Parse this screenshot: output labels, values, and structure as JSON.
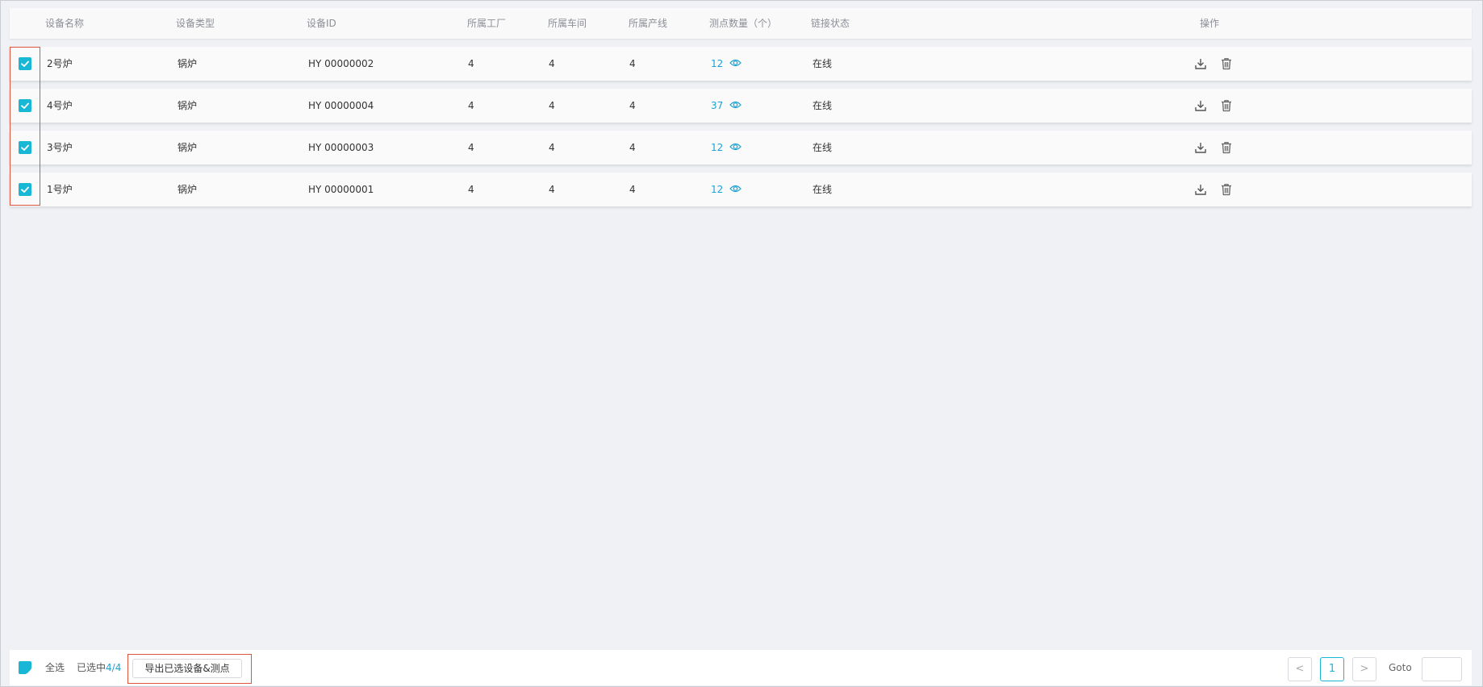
{
  "table": {
    "columns": {
      "name": "设备名称",
      "type": "设备类型",
      "device_id": "设备ID",
      "factory": "所属工厂",
      "workshop": "所属车间",
      "line": "所属产线",
      "points": "测点数量（个）",
      "status": "链接状态",
      "actions": "操作"
    },
    "rows": [
      {
        "checked": true,
        "name": "2号炉",
        "type": "锅炉",
        "device_id": "HY  00000002",
        "factory": "4",
        "workshop": "4",
        "line": "4",
        "points": "12",
        "status": "在线"
      },
      {
        "checked": true,
        "name": "4号炉",
        "type": "锅炉",
        "device_id": "HY  00000004",
        "factory": "4",
        "workshop": "4",
        "line": "4",
        "points": "37",
        "status": "在线"
      },
      {
        "checked": true,
        "name": "3号炉",
        "type": "锅炉",
        "device_id": "HY  00000003",
        "factory": "4",
        "workshop": "4",
        "line": "4",
        "points": "12",
        "status": "在线"
      },
      {
        "checked": true,
        "name": "1号炉",
        "type": "锅炉",
        "device_id": "HY  00000001",
        "factory": "4",
        "workshop": "4",
        "line": "4",
        "points": "12",
        "status": "在线"
      }
    ],
    "row_icons": {
      "points": "eye-icon",
      "download": "download-icon",
      "delete": "trash-icon",
      "checkbox": "checkbox-checked-icon"
    }
  },
  "footer": {
    "select_all_label": "全选",
    "selected_prefix": "已选中",
    "selected_count": "4/4",
    "export_label": "导出已选设备&测点",
    "pagination": {
      "prev": "<",
      "current_page": "1",
      "next": ">",
      "goto_label": "Goto",
      "goto_value": ""
    }
  },
  "colors": {
    "accent": "#19b7d6",
    "link": "#1aa3d4",
    "highlight_border": "#e0533d",
    "background": "#f0f1f5"
  }
}
